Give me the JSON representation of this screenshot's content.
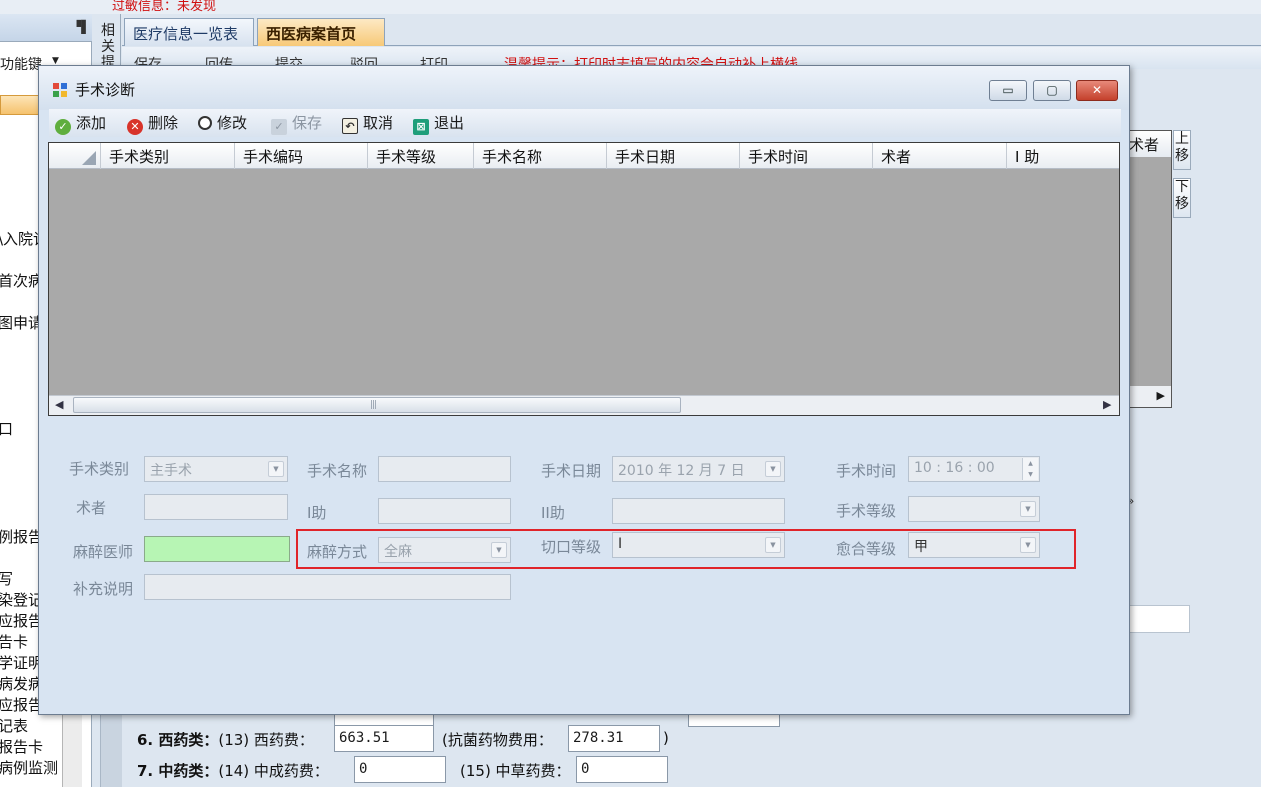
{
  "background": {
    "alert_text": "过敏信息：未发现",
    "function_keys_label": "功能键",
    "related_label": [
      "相",
      "关",
      "提"
    ],
    "tabs": [
      {
        "label": "医疗信息一览表",
        "active": false
      },
      {
        "label": "西医病案首页",
        "active": true
      }
    ],
    "toolbar": [
      "保存",
      "回传",
      "提交",
      "驳回",
      "打印"
    ],
    "hint_text": "温馨提示：打印时志填写的内容会自动补上横线",
    "left_items": [
      "\\入院记",
      "首次病",
      "图申请",
      "口",
      "例报告",
      "写",
      "染登记",
      "应报告",
      "告卡",
      "学证明",
      "病发病",
      "应报告",
      "记表",
      "报告卡",
      "病例监测"
    ],
    "grid_right_header": "术者",
    "move_up": "上移",
    "move_down": "下移",
    "fees": {
      "western_label": "6. 西药类：",
      "western_sub": "(13) 西药费：",
      "western_value": "663.51",
      "antibiotic_label": "(抗菌药物费用：",
      "antibiotic_value": "278.31",
      "antibiotic_close": ")",
      "chinese_label": "7. 中药类：",
      "chinese_sub": "(14) 中成药费：",
      "chinese_patent_value": "0",
      "herbal_label": "(15) 中草药费：",
      "herbal_value": "0"
    }
  },
  "dialog": {
    "title": "手术诊断",
    "window_buttons": {
      "minimize": "▭",
      "maximize": "▢",
      "close": "✕"
    },
    "toolbar": {
      "add": "添加",
      "delete": "删除",
      "edit": "修改",
      "save": "保存",
      "cancel": "取消",
      "exit": "退出"
    },
    "grid": {
      "columns": [
        "手术类别",
        "手术编码",
        "手术等级",
        "手术名称",
        "手术日期",
        "手术时间",
        "术者",
        "I 助"
      ],
      "rows": []
    },
    "form": {
      "surgery_type_label": "手术类别",
      "surgery_type_value": "主手术",
      "surgery_name_label": "手术名称",
      "surgery_name_value": "",
      "surgery_date_label": "手术日期",
      "surgery_date_value": "2010 年 12 月 7 日",
      "surgery_time_label": "手术时间",
      "surgery_time_value": "10 : 16 : 00",
      "surgeon_label": "术者",
      "surgeon_value": "",
      "assistant1_label": "I助",
      "assistant1_value": "",
      "assistant2_label": "II助",
      "assistant2_value": "",
      "surgery_level_label": "手术等级",
      "surgery_level_value": "",
      "anesthetist_label": "麻醉医师",
      "anesthetist_value": "",
      "anesthesia_method_label": "麻醉方式",
      "anesthesia_method_value": "全麻",
      "incision_level_label": "切口等级",
      "incision_level_value": "I",
      "healing_level_label": "愈合等级",
      "healing_level_value": "甲",
      "notes_label": "补充说明",
      "notes_value": ""
    }
  },
  "colors": {
    "accent_tab": "#f7c978",
    "highlight": "#e0242a",
    "anesthetist_field": "#b7f5b4",
    "hint": "#d01010"
  }
}
